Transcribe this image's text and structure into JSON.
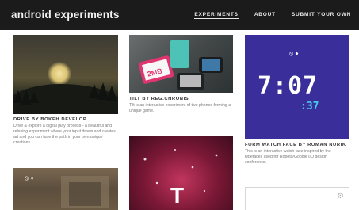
{
  "header": {
    "brand": "android experiments",
    "nav": [
      {
        "label": "EXPERIMENTS",
        "active": true
      },
      {
        "label": "ABOUT",
        "active": false
      },
      {
        "label": "SUBMIT YOUR OWN",
        "active": false
      }
    ]
  },
  "cards": [
    {
      "id": "card-1",
      "title": "DRIVE BY BOKEH DEVELOP",
      "desc": "Drive & explore a digital play process - a beautiful and relaxing experiment where your input draws and creates art and you can tune the path in your own unique creations."
    },
    {
      "id": "card-2",
      "title": "TILT BY REG.CHRONIS",
      "desc": "Tilt is an interactive experiment of two phones forming a unique game."
    },
    {
      "id": "card-3",
      "title": "FORM WATCH FACE BY ROMAN NURIK",
      "desc": "This is an interactive watch face inspired by the typefaces used for Roboto/Google I/O design conference.",
      "clock_time": "7:07",
      "clock_seconds": ":37",
      "clock_icons": "⦸ ♦",
      "accent": "#3a2f9a"
    },
    {
      "id": "card-4",
      "title": "",
      "desc": "",
      "overlay_letter": "T"
    },
    {
      "id": "card-5",
      "title": "",
      "desc": "",
      "icons": "⦸ ♦"
    },
    {
      "id": "card-6",
      "title": "",
      "desc": "",
      "icon": "⚙"
    }
  ],
  "colors": {
    "header_bg": "#1b1b1b",
    "clock_bg": "#3a2f9a",
    "seconds": "#46c8e8",
    "pink": "#c2355d"
  }
}
